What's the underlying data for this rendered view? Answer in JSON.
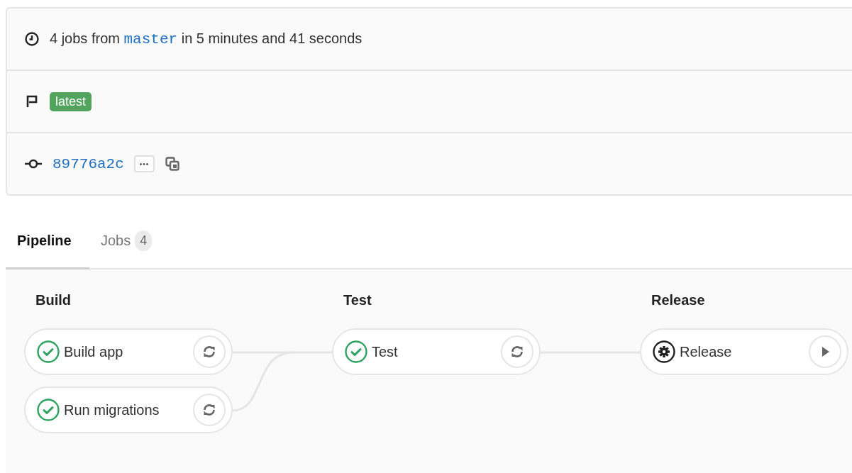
{
  "summary": {
    "duration": {
      "text_before": "4 jobs from",
      "branch": "master",
      "text_after": "in 5 minutes and 41 seconds"
    },
    "badges": [
      {
        "label": "latest",
        "color": "#52a35e"
      }
    ],
    "commit": {
      "sha": "89776a2c",
      "more": "•••"
    }
  },
  "tabs": [
    {
      "label": "Pipeline",
      "selected": true
    },
    {
      "label": "Jobs",
      "count": "4",
      "selected": false
    }
  ],
  "stages": [
    {
      "name": "Build",
      "jobs": [
        {
          "name": "Build app",
          "kind": "passed"
        },
        {
          "name": "Run migrations",
          "kind": "passed"
        }
      ]
    },
    {
      "name": "Test",
      "jobs": [
        {
          "name": "Test",
          "kind": "passed"
        }
      ]
    },
    {
      "name": "Release",
      "jobs": [
        {
          "name": "Release",
          "kind": "manual"
        }
      ]
    }
  ]
}
